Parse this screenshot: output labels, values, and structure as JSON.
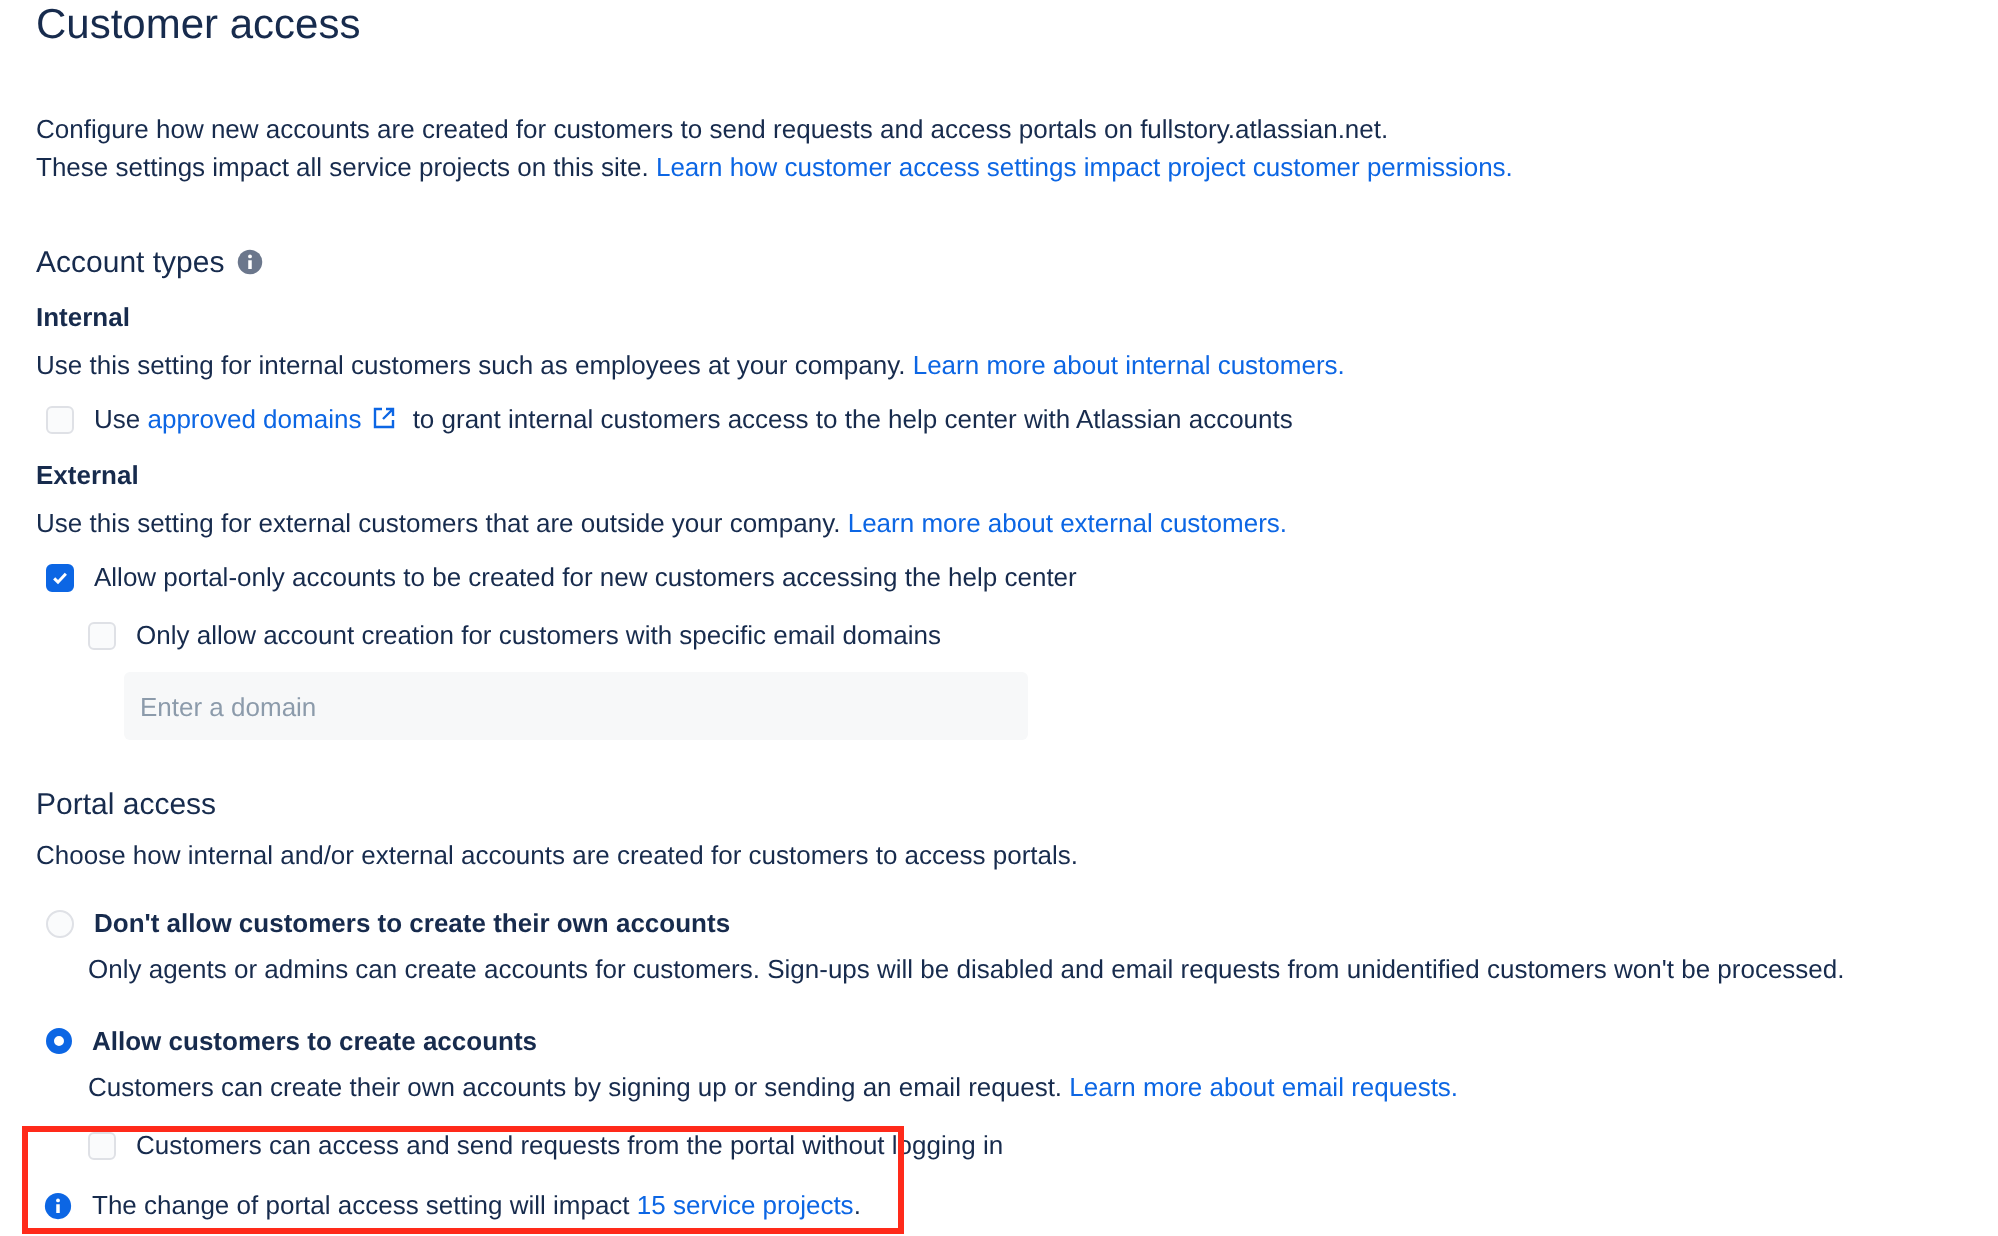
{
  "title": "Customer access",
  "intro": [
    {
      "text": "Configure how new accounts are created for customers to send requests and access portals on fullstory.atlassian.net."
    },
    {
      "text": "These settings impact all service projects on this site. ",
      "link": "Learn how customer access settings impact project customer permissions."
    }
  ],
  "account_types": {
    "heading": "Account types",
    "groups": [
      {
        "label": "Internal",
        "description": {
          "text": "Use this setting for internal customers such as employees at your company. ",
          "link": "Learn more about internal customers."
        },
        "options": [
          {
            "checked": false,
            "before": "Use ",
            "external_link": "approved domains",
            "after": " to grant internal customers access to the help center with Atlassian accounts"
          }
        ]
      },
      {
        "label": "External",
        "description": {
          "text": "Use this setting for external customers that are outside your company. ",
          "link": "Learn more about external customers."
        },
        "options": [
          {
            "checked": true,
            "before": "Allow portal-only accounts to be created for new customers accessing the help center",
            "sub_option": {
              "checked": false,
              "label": "Only allow account creation for customers with specific email domains"
            }
          }
        ],
        "domain_field": {
          "placeholder": "Enter a domain"
        }
      }
    ]
  },
  "portal_access": {
    "heading": "Portal access",
    "description": "Choose how internal and/or external accounts are created for customers to access portals.",
    "choices": [
      {
        "label": "Don't allow customers to create their own accounts",
        "selected": false,
        "description": {
          "text": "Only agents or admins can create accounts for customers. Sign-ups will be disabled and email requests from unidentified customers won't be processed."
        }
      },
      {
        "label": "Allow customers to create accounts",
        "selected": true,
        "description": {
          "text": "Customers can create their own accounts by signing up or sending an email request. ",
          "link": "Learn more about email requests."
        },
        "option": {
          "checked": false,
          "label": "Customers can access and send requests from the portal without logging in"
        }
      }
    ]
  },
  "notice": {
    "text": "The change of portal access setting will impact ",
    "link": "15 service projects",
    "after": "."
  }
}
